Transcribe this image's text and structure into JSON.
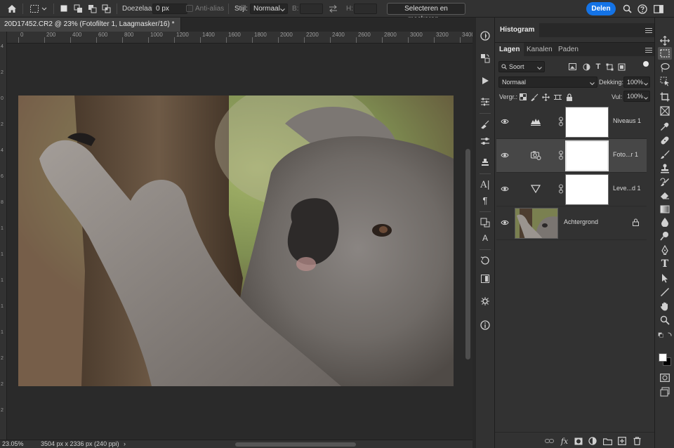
{
  "options_bar": {
    "feather_label": "Doezelaar:",
    "feather_value": "0 px",
    "antialias_label": "Anti-alias",
    "style_label": "Stijl:",
    "style_value": "Normaal",
    "width_label": "B:",
    "height_label": "H:",
    "select_mask_label": "Selecteren en maskeren...",
    "share_label": "Delen"
  },
  "document": {
    "tab_title": "20D17452.CR2 @ 23% (Fotofilter 1, Laagmasker/16) *",
    "close_glyph": "×"
  },
  "ruler": {
    "h_ticks": [
      "0",
      "200",
      "400",
      "600",
      "800",
      "1000",
      "1200",
      "1400",
      "1600",
      "1800",
      "2000",
      "2200",
      "2400",
      "2600",
      "2800",
      "3000",
      "3200",
      "3400"
    ],
    "v_ticks": [
      "4",
      "2",
      "0",
      "2",
      "4",
      "6",
      "8",
      "1",
      "1",
      "1",
      "1",
      "1",
      "2",
      "2",
      "2"
    ]
  },
  "status": {
    "zoom": "23.05%",
    "dimensions": "3504 px x 2336 px (240 ppi)",
    "arrow": "›"
  },
  "panels": {
    "histogram_tab": "Histogram",
    "layer_tabs": [
      "Lagen",
      "Kanalen",
      "Paden"
    ],
    "filter_kind": "Soort",
    "blend_mode": "Normaal",
    "opacity_label": "Dekking:",
    "opacity_value": "100%",
    "lock_label": "Vergr.:",
    "fill_label": "Vul:",
    "fill_value": "100%"
  },
  "layers": [
    {
      "name": "Niveaus 1",
      "type": "levels",
      "selected": false
    },
    {
      "name": "Foto...r 1",
      "type": "photo-filter",
      "selected": true
    },
    {
      "name": "Leve...d 1",
      "type": "gradient-map",
      "selected": false
    },
    {
      "name": "Achtergrond",
      "type": "background",
      "selected": false
    }
  ],
  "colors": {
    "accent": "#1473e6",
    "panel_bg": "#323232",
    "selected_layer": "#474747"
  }
}
